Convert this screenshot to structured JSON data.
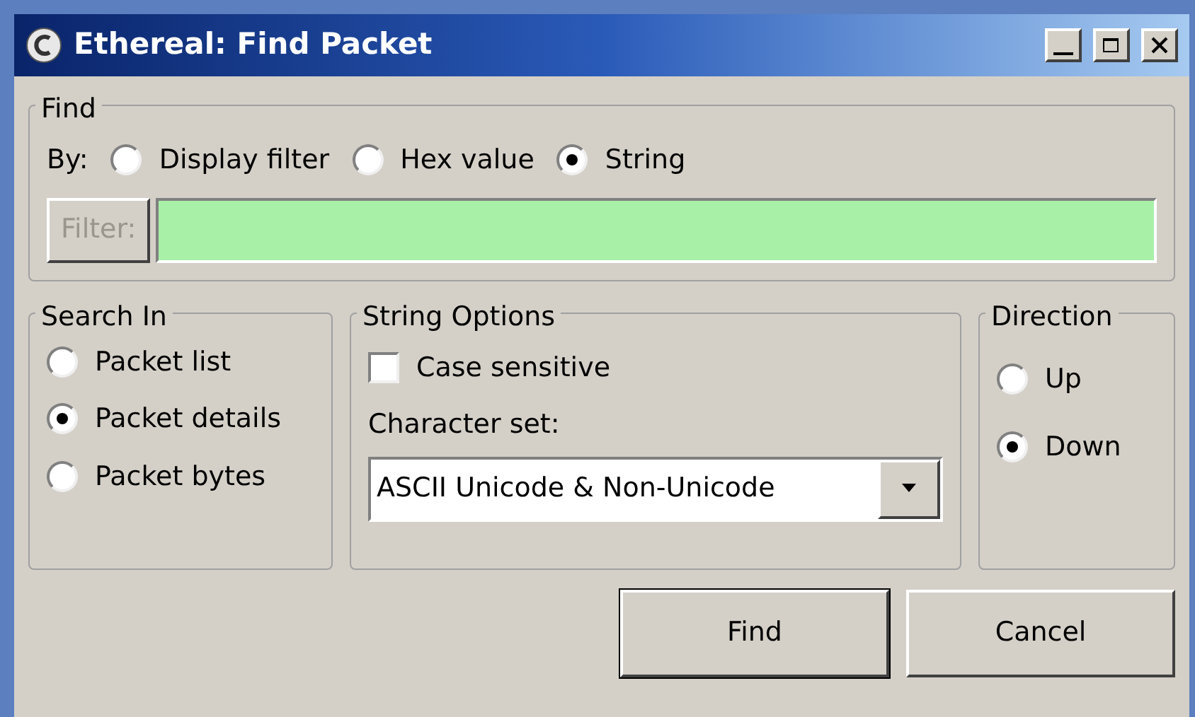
{
  "window": {
    "title": "Ethereal: Find Packet"
  },
  "find": {
    "title": "Find",
    "by_label": "By:",
    "options": [
      {
        "label": "Display filter",
        "selected": false
      },
      {
        "label": "Hex value",
        "selected": false
      },
      {
        "label": "String",
        "selected": true
      }
    ],
    "filter_button": {
      "label": "Filter:",
      "disabled": true
    }
  },
  "search_in": {
    "title": "Search In",
    "options": [
      {
        "label": "Packet list",
        "selected": false
      },
      {
        "label": "Packet details",
        "selected": true
      },
      {
        "label": "Packet bytes",
        "selected": false
      }
    ]
  },
  "string_options": {
    "title": "String Options",
    "case_sensitive": {
      "label": "Case sensitive",
      "checked": false
    },
    "charset_label": "Character set:",
    "charset_value": "ASCII Unicode & Non-Unicode"
  },
  "direction": {
    "title": "Direction",
    "options": [
      {
        "label": "Up",
        "selected": false
      },
      {
        "label": "Down",
        "selected": true
      }
    ]
  },
  "buttons": [
    {
      "label": "Find",
      "default": true
    },
    {
      "label": "Cancel",
      "default": false
    }
  ]
}
